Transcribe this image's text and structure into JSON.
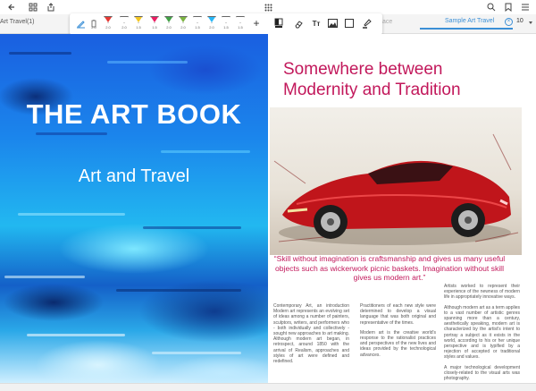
{
  "app": {
    "tab_left_label": "Art Travel(1)",
    "tab_ghost_label": "ace",
    "active_tab_label": "Sample Art Travel",
    "page_number": "10"
  },
  "toolbar": {
    "pens": [
      {
        "size": "2.0",
        "color": "#ffffff"
      },
      {
        "size": "2.0",
        "color": "#e53935"
      },
      {
        "size": "2.0",
        "color": "#ffffff"
      },
      {
        "size": "1.5",
        "color": "#f3c623"
      },
      {
        "size": "1.5",
        "color": "#e91e63"
      },
      {
        "size": "2.0",
        "color": "#43a047"
      },
      {
        "size": "2.0",
        "color": "#7cb342"
      },
      {
        "size": "1.5",
        "color": "#ffffff"
      },
      {
        "size": "2.0",
        "color": "#29b6f6"
      },
      {
        "size": "1.5",
        "color": "#ffffff"
      },
      {
        "size": "1.5",
        "color": "#ffffff"
      }
    ],
    "add_label": "+",
    "text_tool_label": "Tт"
  },
  "left_page": {
    "title": "THE ART BOOK",
    "subtitle": "Art and Travel"
  },
  "right_page": {
    "headline_line1": "Somewhere between",
    "headline_line2": "Modernity and Tradition",
    "quote": "“Skill without imagination is craftsmanship and gives us many useful objects such as wickerwork picnic baskets. Imagination without skill gives us modern art.”",
    "col1": [
      "Contemporary Art, an introduction Modern art represents an evolving set of ideas among a number of painters, sculptors, writers, and performers who - both individually and collectively - sought new approaches to art making. Although modern art began, in retrospect, around 1850 with the arrival of Realism, approaches and styles of art were defined and redefined."
    ],
    "col2": [
      "Practitioners of each new style were determined to develop a visual language that was both original and representative of the times.",
      "Modern art is the creative world's response to the rationalist practices and perspectives of the new lives and ideas provided by the technological advances."
    ],
    "col3": [
      "Artists worked to represent their experience of the newness of modern life in appropriately innovative ways.",
      "Although modern art as a term applies to a vast number of artistic genres spanning more than a century, aesthetically speaking, modern art is characterized by the artist's intent to portray a subject as it exists in the world, according to his or her unique perspective and is typified by a rejection of accepted or traditional styles and values.",
      "A major technological development closely-related to the visual arts was photography."
    ]
  },
  "colors": {
    "accent": "#c2185b",
    "active_tab": "#3b8fd6"
  },
  "icons": [
    "back-arrow-icon",
    "grid-icon",
    "share-icon",
    "apps-icon",
    "search-icon",
    "bookmark-icon",
    "menu-icon",
    "pen-select-icon",
    "eraser-icon",
    "text-icon",
    "image-icon",
    "shape-icon",
    "highlighter-icon",
    "color-swatch-icon"
  ]
}
